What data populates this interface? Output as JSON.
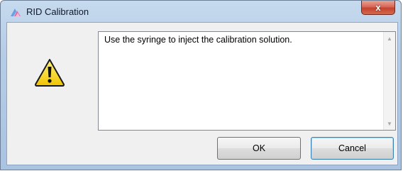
{
  "window": {
    "title": "RID Calibration",
    "close_glyph": "x",
    "app_icon": "calibration-app-icon"
  },
  "message": {
    "icon": "warning-icon",
    "text": "Use the syringe to inject the calibration solution.",
    "scroll_up_glyph": "▲",
    "scroll_down_glyph": "▼"
  },
  "buttons": {
    "ok_label": "OK",
    "cancel_label": "Cancel"
  },
  "colors": {
    "title_bar": "#b6cde6",
    "close_button": "#c4432f",
    "warning_yellow": "#f5d41f",
    "focus_border": "#3c7fb1"
  }
}
